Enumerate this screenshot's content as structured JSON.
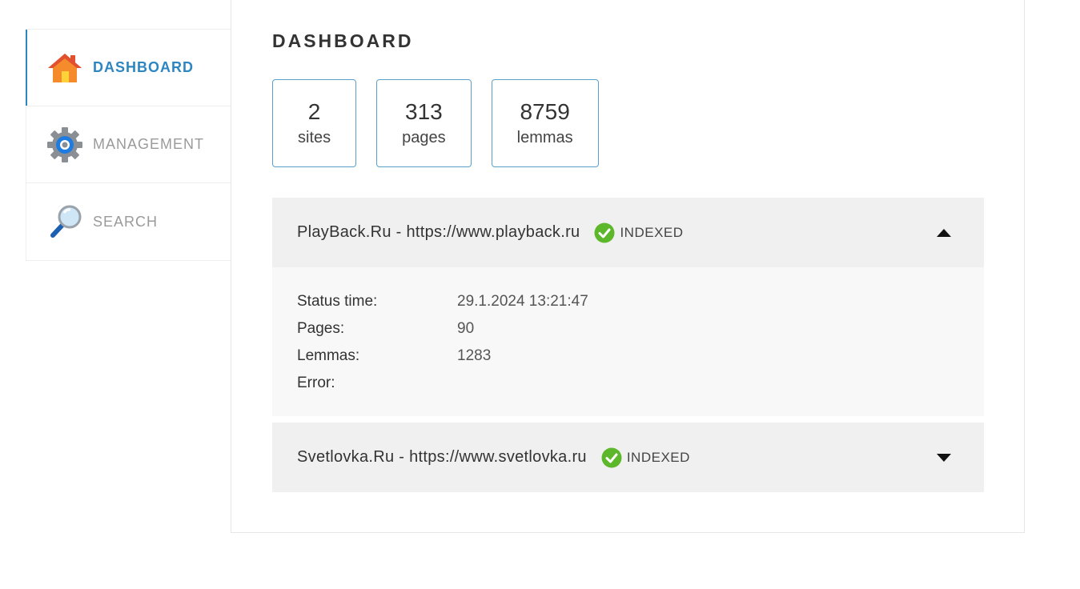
{
  "sidebar": {
    "items": [
      {
        "label": "DASHBOARD",
        "icon": "home-icon",
        "active": true
      },
      {
        "label": "MANAGEMENT",
        "icon": "gear-icon",
        "active": false
      },
      {
        "label": "SEARCH",
        "icon": "magnifier-icon",
        "active": false
      }
    ]
  },
  "main": {
    "title": "DASHBOARD",
    "stats": [
      {
        "value": "2",
        "label": "sites"
      },
      {
        "value": "313",
        "label": "pages"
      },
      {
        "value": "8759",
        "label": "lemmas"
      }
    ],
    "sites": [
      {
        "name": "PlayBack.Ru - https://www.playback.ru",
        "status": "INDEXED",
        "expanded": true,
        "details": {
          "status_time_label": "Status time:",
          "status_time": "29.1.2024 13:21:47",
          "pages_label": "Pages:",
          "pages": "90",
          "lemmas_label": "Lemmas:",
          "lemmas": "1283",
          "error_label": "Error:",
          "error": ""
        }
      },
      {
        "name": "Svetlovka.Ru - https://www.svetlovka.ru",
        "status": "INDEXED",
        "expanded": false
      }
    ]
  },
  "colors": {
    "accent": "#2e86c1",
    "status_ok": "#5cb82a",
    "panel": "#f0f0f0"
  }
}
